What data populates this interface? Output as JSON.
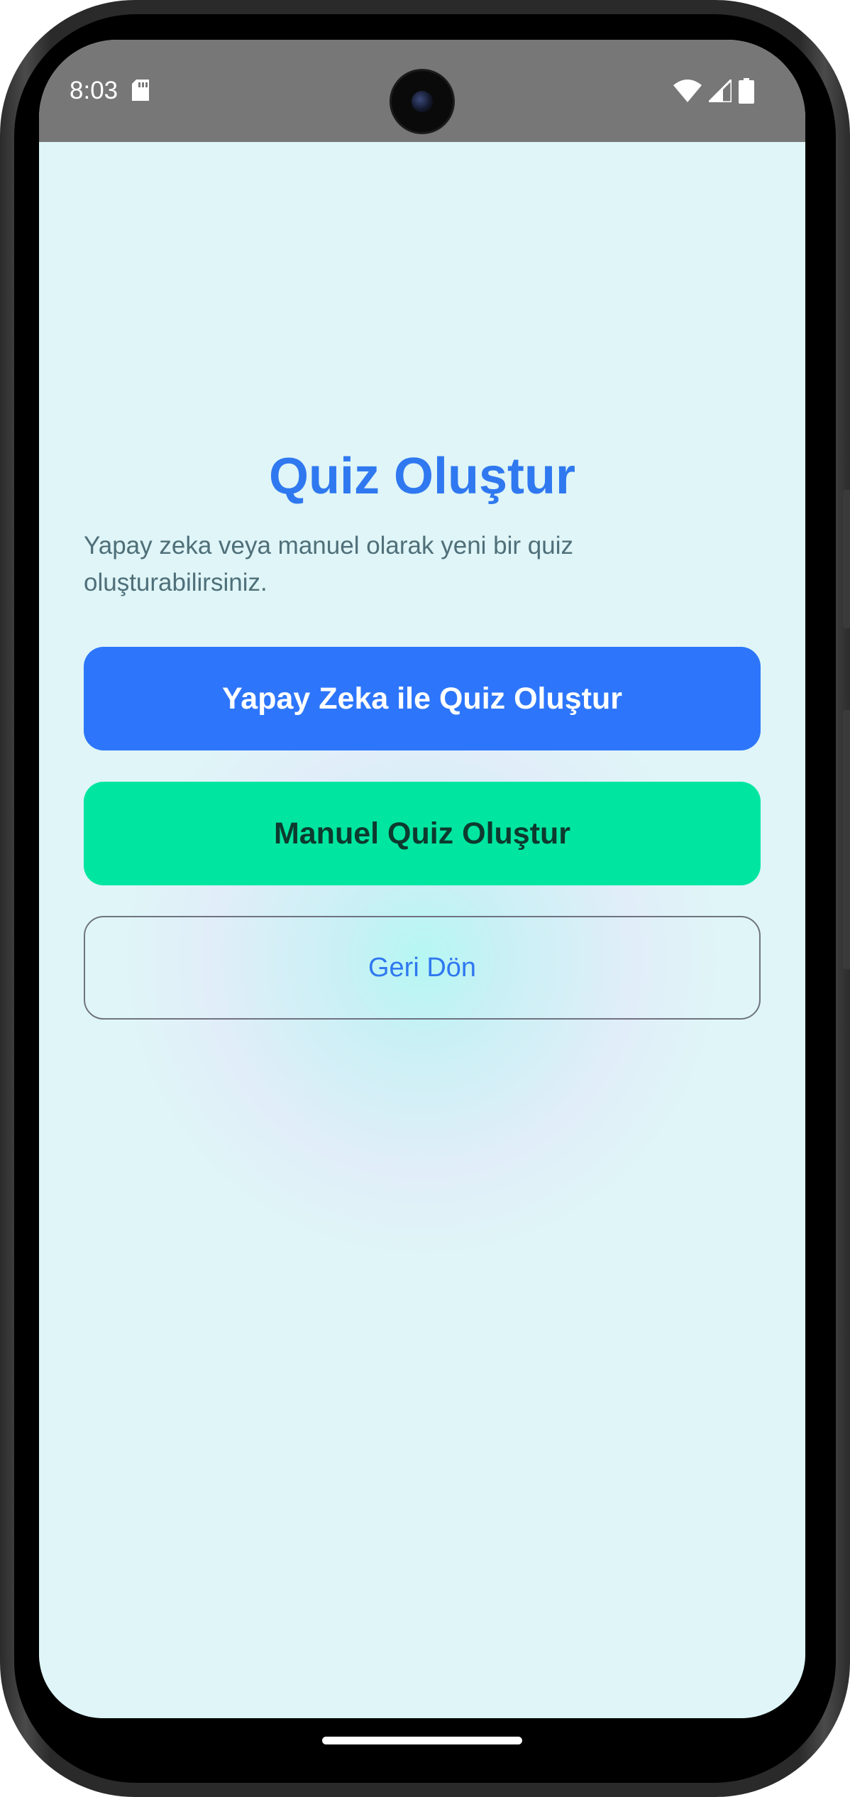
{
  "status_bar": {
    "time": "8:03",
    "icons": [
      "sd-card-icon",
      "wifi-icon",
      "cellular-signal-icon",
      "battery-icon"
    ]
  },
  "main": {
    "title": "Quiz Oluştur",
    "subtitle": "Yapay zeka veya manuel olarak yeni bir quiz oluşturabilirsiniz.",
    "ai_button_label": "Yapay Zeka ile Quiz Oluştur",
    "manual_button_label": "Manuel Quiz Oluştur",
    "back_button_label": "Geri Dön"
  },
  "colors": {
    "primary": "#2d76fb",
    "accent": "#00e6a0",
    "background": "#dff5f7",
    "status_bar": "#777777"
  }
}
